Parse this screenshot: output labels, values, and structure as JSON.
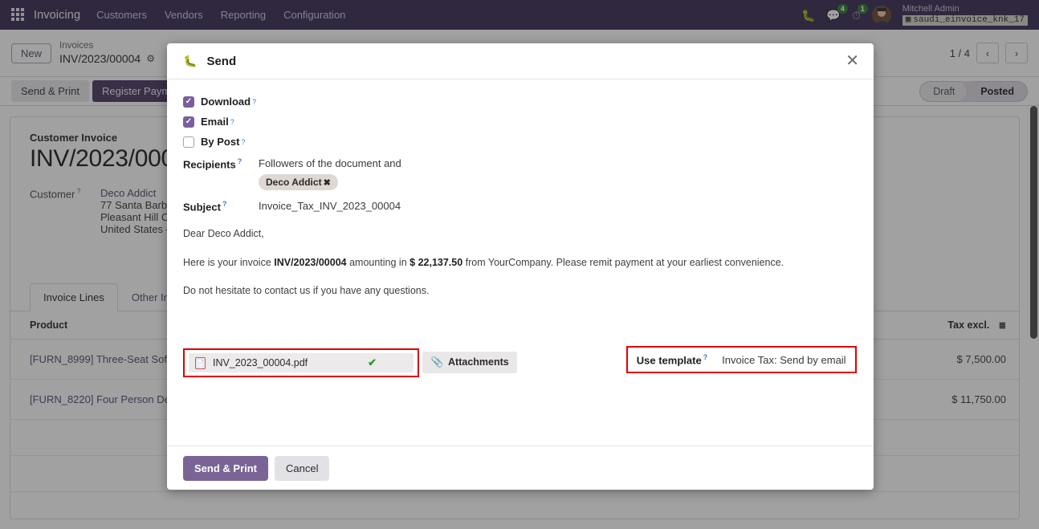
{
  "navbar": {
    "apps_icon": "apps-grid-icon",
    "brand": "Invoicing",
    "menu": [
      {
        "label": "Customers"
      },
      {
        "label": "Vendors"
      },
      {
        "label": "Reporting"
      },
      {
        "label": "Configuration"
      }
    ],
    "bug_icon": "bug-icon",
    "messages_icon": "chat-icon",
    "messages_count": "4",
    "activities_icon": "clock-icon",
    "activities_count": "1",
    "avatar": "user-avatar",
    "user_name": "Mitchell Admin",
    "database_icon": "database-icon",
    "database": "saudi_einvoice_knk_17"
  },
  "control_panel": {
    "new_label": "New",
    "breadcrumb_parent": "Invoices",
    "breadcrumb_current": "INV/2023/00004",
    "gear_icon": "gear-icon",
    "pager": "1 / 4",
    "prev_icon": "chevron-left-icon",
    "next_icon": "chevron-right-icon"
  },
  "sheet_bar": {
    "send_print": "Send & Print",
    "register_payment": "Register Payment",
    "status": [
      {
        "label": "Draft",
        "active": false
      },
      {
        "label": "Posted",
        "active": true
      }
    ]
  },
  "invoice": {
    "doc_kind": "Customer Invoice",
    "doc_number": "INV/2023/00004",
    "customer_label": "Customer",
    "customer_name": "Deco Addict",
    "address_line1": "77 Santa Barbara",
    "address_line2": "Pleasant Hill CA",
    "address_line3": "United States – ",
    "tabs": [
      {
        "label": "Invoice Lines",
        "active": true
      },
      {
        "label": "Other Info",
        "active": false
      }
    ],
    "table": {
      "columns": [
        "Product",
        "Tax excl."
      ],
      "options_icon": "sliders-icon",
      "rows": [
        {
          "product": "[FURN_8999] Three-Seat Sofa",
          "tax_excl": "$ 7,500.00"
        },
        {
          "product": "[FURN_8220] Four Person Desk",
          "tax_excl": "$ 11,750.00"
        }
      ]
    }
  },
  "modal": {
    "header_icon": "bug-icon",
    "title": "Send",
    "close_icon": "close-icon",
    "checkboxes": [
      {
        "label": "Download",
        "checked": true,
        "help": "?"
      },
      {
        "label": "Email",
        "checked": true,
        "help": "?"
      },
      {
        "label": "By Post",
        "checked": false,
        "help": "?"
      }
    ],
    "recipients_label": "Recipients",
    "recipients_value": "Followers of the document and",
    "recipient_tag": "Deco Addict",
    "recipient_tag_remove": "✖",
    "subject_label": "Subject",
    "subject_value": "Invoice_Tax_INV_2023_00004",
    "body": {
      "greeting": "Dear Deco Addict,",
      "line_pre": "Here is your invoice ",
      "invoice_ref": "INV/2023/00004",
      "line_mid": " amounting in ",
      "amount": "$ 22,137.50",
      "line_post": " from YourCompany. Please remit payment at your earliest convenience.",
      "closing": "Do not hesitate to contact us if you have any questions."
    },
    "attachment": {
      "pdf_icon": "pdf-file-icon",
      "filename": "INV_2023_00004.pdf",
      "check_icon": "✔",
      "attachments_button": "Attachments",
      "paperclip_icon": "paperclip-icon"
    },
    "template": {
      "label": "Use template",
      "help": "?",
      "value": "Invoice Tax: Send by email"
    },
    "footer": {
      "submit": "Send & Print",
      "cancel": "Cancel"
    },
    "highlight_color": "#e00000"
  }
}
